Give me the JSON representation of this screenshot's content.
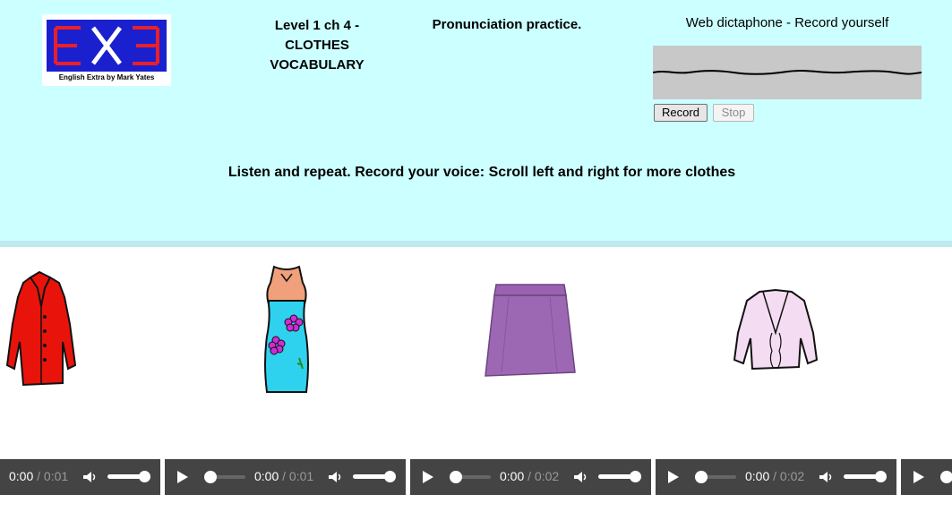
{
  "header": {
    "logo_text": "EXE",
    "logo_caption": "English Extra by Mark Yates",
    "level_lines": [
      "Level 1 ch 4 -",
      "CLOTHES",
      "VOCABULARY"
    ],
    "practice_title": "Pronunciation practice.",
    "dictaphone_title": "Web dictaphone - Record yourself",
    "record_label": "Record",
    "stop_label": "Stop",
    "instructions": "Listen and repeat. Record your voice: Scroll left and right for more clothes"
  },
  "colors": {
    "header_bg": "#ccffff",
    "logo_blue": "#1b20cf",
    "logo_red": "#e8202a",
    "player_bg": "#444444"
  },
  "items": [
    {
      "icon": "red-coat"
    },
    {
      "icon": "blue-flower-dress"
    },
    {
      "icon": "purple-skirt"
    },
    {
      "icon": "pink-blouse"
    }
  ],
  "players": [
    {
      "current": "0:00",
      "duration": "0:01"
    },
    {
      "current": "0:00",
      "duration": "0:01"
    },
    {
      "current": "0:00",
      "duration": "0:02"
    },
    {
      "current": "0:00",
      "duration": "0:02"
    }
  ]
}
